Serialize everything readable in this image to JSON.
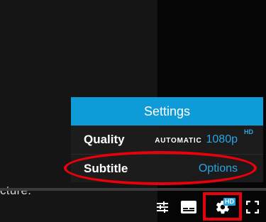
{
  "video": {
    "caption_fragment": "cture."
  },
  "settings_menu": {
    "title": "Settings",
    "rows": [
      {
        "label": "Quality",
        "tag": "AUTOMATIC",
        "value": "1080p",
        "badge": "HD"
      },
      {
        "label": "Subtitle",
        "value": "Options"
      }
    ]
  },
  "controls": {
    "settings_badge": "HD",
    "icons": [
      "adjust-sliders-icon",
      "subtitles-icon",
      "gear-icon",
      "fullscreen-icon"
    ]
  },
  "colors": {
    "accent": "#0e9bd8",
    "value_text": "#2aa5e3",
    "annotation": "#e8000b"
  }
}
